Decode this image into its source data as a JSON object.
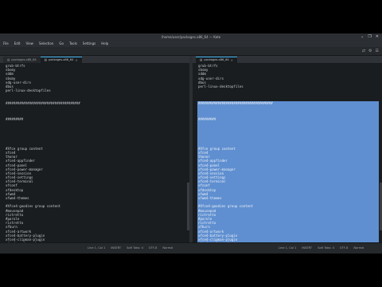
{
  "window": {
    "title": "/home/user/packages.x86_64 — Kate",
    "controls": [
      "⌄",
      "❐",
      "✕"
    ]
  },
  "menu": [
    "File",
    "Edit",
    "View",
    "Selection",
    "Go",
    "Tools",
    "Settings",
    "Help"
  ],
  "toolbar": {
    "icons": [
      "⇄",
      "⚙",
      "☰"
    ]
  },
  "panes": {
    "left": {
      "tabs": [
        {
          "label": "packages.x86_64",
          "active": false
        },
        {
          "label": "packages.x86_64",
          "active": true
        }
      ],
      "lines": [
        "grub-btrfs",
        "sbsmy",
        "sddm",
        "sbsmy",
        "xdg-user-dirs",
        "dbus",
        "perl-linux-desktopfiles",
        "",
        "",
        "######################################",
        "",
        "",
        "",
        "#########",
        "",
        "",
        "",
        "",
        "",
        "",
        "#Xfce group content",
        "xfce4",
        "thunar",
        "xfce4-appfinder",
        "xfce4-panel",
        "xfce4-power-manager",
        "xfce4-session",
        "xfce4-settings",
        "xfce4-terminal",
        "xfconf",
        "xfdesktop",
        "xfwm4",
        "xfwm4-themes",
        "",
        "#Xfce4-goodies group content",
        "#mousepad",
        "ristretto",
        "#parole",
        "ristretto",
        "xfburn",
        "xfce4-artwork",
        "xfce4-battery-plugin",
        "xfce4-clipman-plugin",
        "xfce4-cpufreq-plugin",
        "xfce4-cpugraph-plugin",
        "xfce4-datetime-plugin",
        "xfce4-dict",
        "xfce4-diskperf-plugin"
      ]
    },
    "right": {
      "tabs": [
        {
          "label": "packages.x86_64",
          "active": true
        }
      ],
      "lines": [
        "grub-btrfs",
        "sbsmy",
        "sddm",
        "xdg-user-dirs",
        "dbus",
        "perl-linux-desktopfiles",
        "",
        "",
        "",
        "######################################",
        "",
        "",
        "",
        "#########",
        "",
        "",
        "",
        "",
        "",
        "",
        "#Xfce group content",
        "xfce4",
        "thunar",
        "xfce4-appfinder",
        "xfce4-panel",
        "xfce4-power-manager",
        "xfce4-session",
        "xfce4-settings",
        "xfce4-terminal",
        "xfconf",
        "xfdesktop",
        "xfwm4",
        "xfwm4-themes",
        "",
        "#Xfce4-goodies group content",
        "#mousepad",
        "ristretto",
        "#parole",
        "ristretto",
        "xfburn",
        "xfce4-artwork",
        "xfce4-battery-plugin",
        "xfce4-clipman-plugin",
        "xfce4-cpufreq-plugin",
        "xfce4-cpugraph-plugin",
        "xfce4-datetime-plugin",
        "xfce4-dict",
        "xfce4-diskperf-plugin"
      ],
      "selection_start": 9
    }
  },
  "statusbar": {
    "left": [
      "Line 1, Col 1",
      "INSERT",
      "Soft Tabs: 4",
      "UTF-8",
      "Normal"
    ],
    "right": [
      "Line 1, Col 1",
      "INSERT",
      "Soft Tabs: 4",
      "UTF-8",
      "Normal"
    ]
  },
  "colors": {
    "selection": "#5f8fd0",
    "accent": "#3daee9",
    "background": "#1a1d20"
  }
}
